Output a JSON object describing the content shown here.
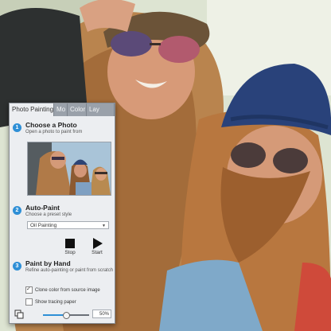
{
  "tabs": [
    {
      "label": "Photo Painting",
      "active": true
    },
    {
      "label": "Mo",
      "active": false
    },
    {
      "label": "Color",
      "active": false
    },
    {
      "label": "Lay",
      "active": false
    }
  ],
  "sections": {
    "choose": {
      "number": "1",
      "title": "Choose a Photo",
      "subtitle": "Open a photo to paint from"
    },
    "auto": {
      "number": "2",
      "title": "Auto-Paint",
      "subtitle": "Choose a preset style",
      "preset": "Oil Painting"
    },
    "hand": {
      "number": "3",
      "title": "Paint by Hand",
      "subtitle": "Refine auto-painting or paint from scratch"
    }
  },
  "controls": {
    "stop_label": "Stop",
    "start_label": "Start"
  },
  "options": {
    "clone_label": "Clone color from source image",
    "clone_checked": true,
    "tracing_label": "Show tracing paper",
    "tracing_checked": false
  },
  "zoom": {
    "value": "50%",
    "fraction": 0.5
  },
  "icons": [
    "step-1-icon",
    "step-2-icon",
    "step-3-icon",
    "stop-icon",
    "start-icon",
    "dropdown-arrow-icon",
    "layers-icon"
  ],
  "colors": {
    "accent": "#2e8fd6",
    "tab_bar": "#9aa1aa",
    "panel_bg": "#eceef1"
  }
}
